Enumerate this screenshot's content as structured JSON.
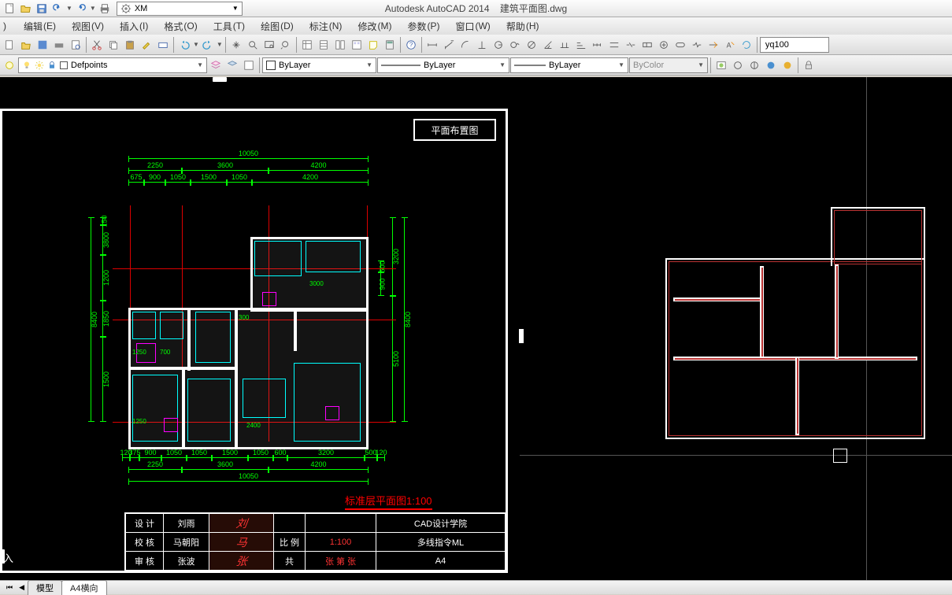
{
  "title_bar": {
    "app_name": "Autodesk AutoCAD 2014",
    "doc_name": "建筑平面图.dwg",
    "workspace_label": "XM"
  },
  "menu": {
    "items": [
      {
        "label": "编辑",
        "ak": "(E)"
      },
      {
        "label": "视图",
        "ak": "(V)"
      },
      {
        "label": "插入",
        "ak": "(I)"
      },
      {
        "label": "格式",
        "ak": "(O)"
      },
      {
        "label": "工具",
        "ak": "(T)"
      },
      {
        "label": "绘图",
        "ak": "(D)"
      },
      {
        "label": "标注",
        "ak": "(N)"
      },
      {
        "label": "修改",
        "ak": "(M)"
      },
      {
        "label": "参数",
        "ak": "(P)"
      },
      {
        "label": "窗口",
        "ak": "(W)"
      },
      {
        "label": "帮助",
        "ak": "(H)"
      }
    ]
  },
  "layers": {
    "current": "Defpoints"
  },
  "properties": {
    "color_label": "ByLayer",
    "linetype_label": "ByLayer",
    "lineweight_label": "ByLayer",
    "plotstyle_label": "ByColor"
  },
  "search_box": {
    "value": "yq100"
  },
  "drawing": {
    "titleblock_label": "平面布置图",
    "plan_title": "标准层平面图1:100",
    "dims_top_total": "10050",
    "dims_top_row2": [
      "2250",
      "3600",
      "4200"
    ],
    "dims_top_row3": [
      "675",
      "900",
      "1050",
      "1500",
      "1050",
      "4200"
    ],
    "dims_left": {
      "total": "8400",
      "seg": [
        "1500",
        "1850",
        "1200",
        "3800",
        "150"
      ]
    },
    "dims_right": {
      "total": "8400",
      "seg": [
        "3200",
        "5100",
        "900",
        "500"
      ]
    },
    "dims_bot_total": "10050",
    "dims_bot_row2": [
      "2250",
      "3600",
      "4200"
    ],
    "dims_bot_row3": [
      "120",
      "375",
      "900",
      "1050",
      "1050",
      "1500",
      "1050",
      "600",
      "3200",
      "500",
      "120"
    ],
    "interior_labels": [
      "1250",
      "700",
      "300",
      "3000",
      "2400",
      "1250"
    ],
    "tblk": {
      "rows": [
        {
          "label": "设 计",
          "name": "刘雨",
          "sig": "刘",
          "m1": "",
          "m2": "",
          "right": "CAD设计学院"
        },
        {
          "label": "校 核",
          "name": "马朝阳",
          "sig": "马",
          "m1": "比 例",
          "m2": "1:100",
          "right": "多线指令ML"
        },
        {
          "label": "审 核",
          "name": "张波",
          "sig": "张",
          "m1": "共",
          "m2": "张 第 张",
          "right": "A4"
        }
      ]
    }
  },
  "command_tail": "入",
  "bottom_tabs": {
    "model": "模型",
    "layout": "A4横向"
  }
}
